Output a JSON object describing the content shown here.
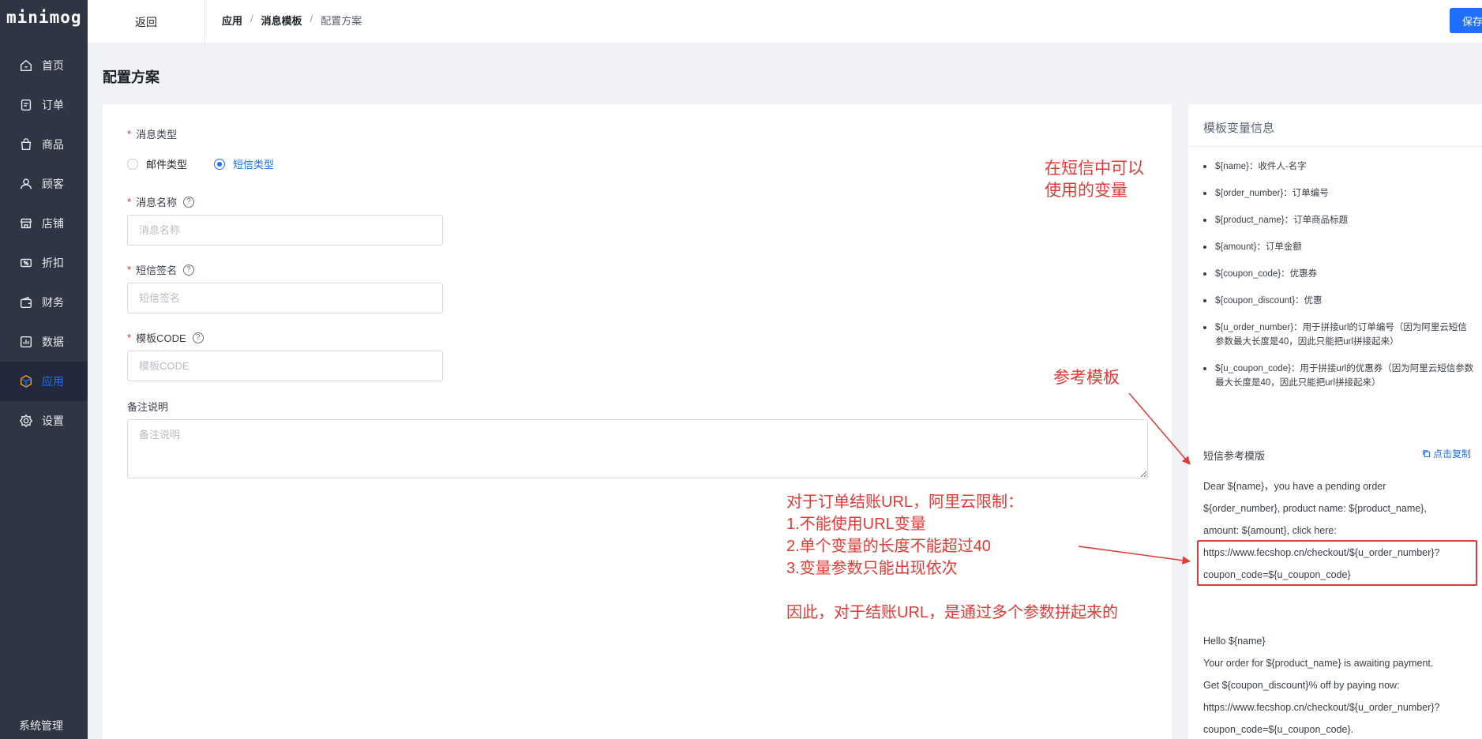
{
  "app": {
    "logo": "minimog"
  },
  "sidebar": {
    "items": [
      {
        "label": "首页",
        "icon": "home-icon"
      },
      {
        "label": "订单",
        "icon": "order-icon"
      },
      {
        "label": "商品",
        "icon": "bag-icon"
      },
      {
        "label": "顾客",
        "icon": "user-icon"
      },
      {
        "label": "店铺",
        "icon": "store-icon"
      },
      {
        "label": "折扣",
        "icon": "discount-icon"
      },
      {
        "label": "财务",
        "icon": "wallet-icon"
      },
      {
        "label": "数据",
        "icon": "chart-icon"
      },
      {
        "label": "应用",
        "icon": "cube-icon",
        "active": true
      },
      {
        "label": "设置",
        "icon": "gear-icon"
      }
    ],
    "system": "系统管理"
  },
  "topbar": {
    "back": "返回",
    "breadcrumb": [
      "应用",
      "消息模板",
      "配置方案"
    ],
    "save": "保存"
  },
  "page": {
    "title": "配置方案"
  },
  "form": {
    "msg_type_label": "消息类型",
    "radio_email": "邮件类型",
    "radio_sms": "短信类型",
    "selected": "短信类型",
    "name_label": "消息名称",
    "name_placeholder": "消息名称",
    "sign_label": "短信签名",
    "sign_placeholder": "短信签名",
    "code_label": "模板CODE",
    "code_placeholder": "模板CODE",
    "note_label": "备注说明",
    "note_placeholder": "备注说明"
  },
  "annotations": {
    "vars_note_line1": "在短信中可以",
    "vars_note_line2": "使用的变量",
    "ref_note": "参考模板",
    "limit_lines": [
      "对于订单结账URL，阿里云限制：",
      "1.不能使用URL变量",
      "2.单个变量的长度不能超过40",
      "3.变量参数只能出现依次"
    ],
    "conclusion": "因此，对于结账URL，是通过多个参数拼起来的"
  },
  "side": {
    "title": "模板变量信息",
    "variables": [
      "${name}：收件人-名字",
      "${order_number}：订单编号",
      "${product_name}：订单商品标题",
      "${amount}：订单金额",
      "${coupon_code}：优惠券",
      "${coupon_discount}：优惠",
      "${u_order_number}：用于拼接url的订单编号（因为阿里云短信参数最大长度是40，因此只能把url拼接起来）",
      "${u_coupon_code}：用于拼接url的优惠券（因为阿里云短信参数最大长度是40，因此只能把url拼接起来）"
    ],
    "ref_title": "短信参考模版",
    "copy": "点击复制",
    "template1_lines": [
      "Dear ${name}，you have a pending order",
      "${order_number}, product name: ${product_name},",
      "amount: ${amount}, click here:",
      "https://www.fecshop.cn/checkout/${u_order_number}?",
      "coupon_code=${u_coupon_code}"
    ],
    "template2_lines": [
      "Hello ${name}",
      "Your order for ${product_name} is awaiting payment.",
      "Get ${coupon_discount}% off by paying now:",
      "https://www.fecshop.cn/checkout/${u_order_number}?",
      "coupon_code=${u_coupon_code}."
    ]
  },
  "colors": {
    "sidebar": "#2f3542",
    "accent": "#1e6eff",
    "annotation": "#e53935"
  }
}
